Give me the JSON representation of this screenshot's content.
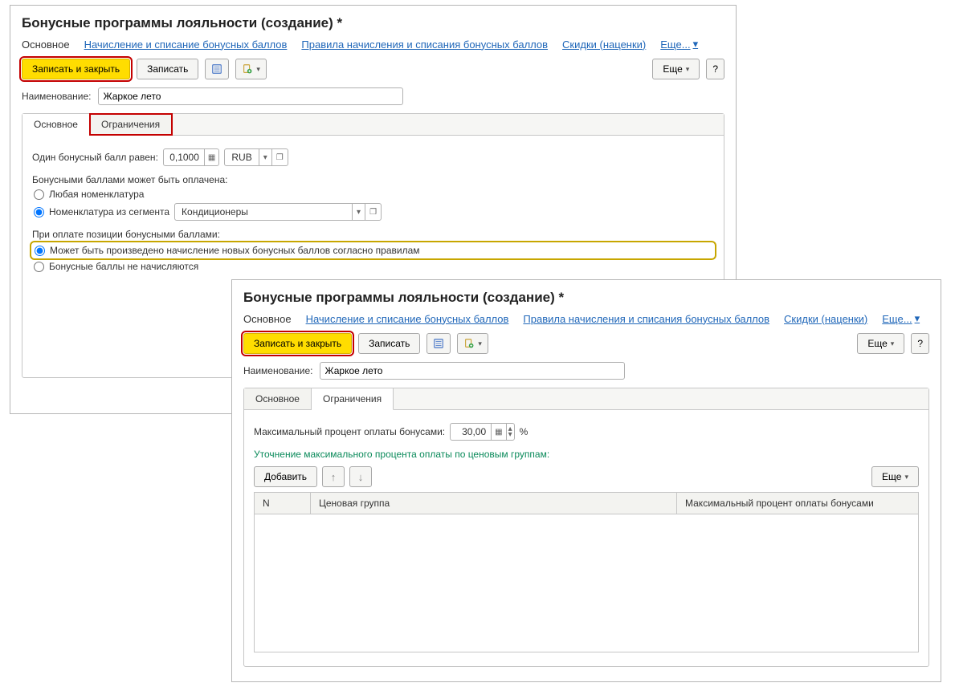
{
  "w1": {
    "title": "Бонусные программы лояльности (создание) *",
    "tabs": {
      "main": "Основное",
      "accrual": "Начисление и списание бонусных баллов",
      "rules": "Правила начисления и списания бонусных баллов",
      "disc": "Скидки (наценки)",
      "more": "Еще..."
    },
    "toolbar": {
      "saveClose": "Записать и закрыть",
      "save": "Записать",
      "more": "Еще",
      "help": "?"
    },
    "name": {
      "label": "Наименование:",
      "value": "Жаркое лето"
    },
    "subtabs": {
      "main": "Основное",
      "limits": "Ограничения"
    },
    "body": {
      "pointEquals": "Один бонусный балл равен:",
      "pointValue": "0,1000",
      "currency": "RUB",
      "paidByPoints": "Бонусными баллами может быть оплачена:",
      "anyNomen": "Любая номенклатура",
      "segNomen": "Номенклатура из сегмента",
      "segment": "Кондиционеры",
      "onPay": "При оплате позиции бонусными баллами:",
      "accrueNew": "Может быть произведено начисление новых бонусных баллов согласно правилам",
      "noAccrue": "Бонусные баллы не начисляются"
    }
  },
  "w2": {
    "title": "Бонусные программы лояльности (создание) *",
    "tabs": {
      "main": "Основное",
      "accrual": "Начисление и списание бонусных баллов",
      "rules": "Правила начисления и списания бонусных баллов",
      "disc": "Скидки (наценки)",
      "more": "Еще..."
    },
    "toolbar": {
      "saveClose": "Записать и закрыть",
      "save": "Записать",
      "more": "Еще",
      "help": "?"
    },
    "name": {
      "label": "Наименование:",
      "value": "Жаркое лето"
    },
    "subtabs": {
      "main": "Основное",
      "limits": "Ограничения"
    },
    "body": {
      "maxPercent": "Максимальный процент оплаты бонусами:",
      "maxValue": "30,00",
      "pct": "%",
      "clarify": "Уточнение максимального процента оплаты по ценовым группам:",
      "add": "Добавить",
      "more": "Еще",
      "col1": "N",
      "col2": "Ценовая группа",
      "col3": "Максимальный процент оплаты бонусами"
    }
  }
}
